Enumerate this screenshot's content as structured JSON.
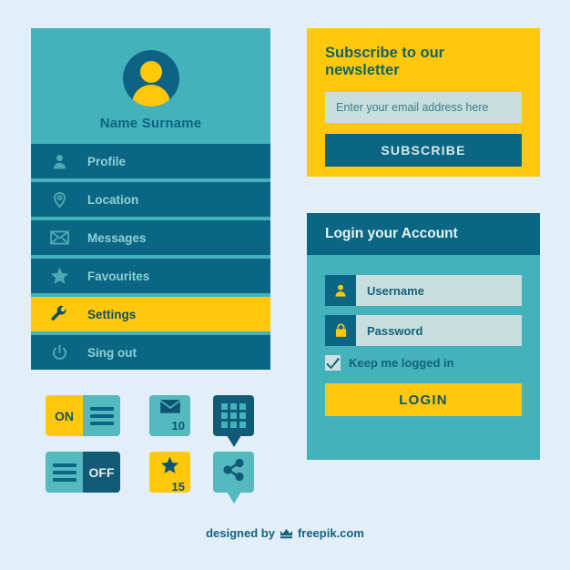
{
  "colors": {
    "page_bg": "#e2eff8",
    "teal": "#43b2ba",
    "teal_light": "#55b9c0",
    "dark_blue": "#0b6683",
    "yellow": "#ffc80d",
    "input_bg": "#c6dfdc",
    "menu_text": "#8fd0d6"
  },
  "profile_card": {
    "avatar_icon": "user-avatar-icon",
    "name": "Name Surname",
    "menu": [
      {
        "label": "Profile",
        "icon": "person-icon",
        "active": false
      },
      {
        "label": "Location",
        "icon": "map-pin-icon",
        "active": false
      },
      {
        "label": "Messages",
        "icon": "envelope-icon",
        "active": false
      },
      {
        "label": "Favourites",
        "icon": "star-icon",
        "active": false
      },
      {
        "label": "Settings",
        "icon": "wrench-icon",
        "active": true
      },
      {
        "label": "Sing out",
        "icon": "power-icon",
        "active": false
      }
    ]
  },
  "newsletter": {
    "title": "Subscribe to our newsletter",
    "email_placeholder": "Enter your email address here",
    "email_value": "",
    "subscribe_label": "SUBSCRIBE"
  },
  "login": {
    "title": "Login your Account",
    "username_icon": "person-icon",
    "username_label": "Username",
    "password_icon": "lock-icon",
    "password_label": "Password",
    "keep_logged_in_label": "Keep me logged in",
    "keep_logged_in_checked": true,
    "checkbox_icon": "checkmark-icon",
    "login_label": "LOGIN"
  },
  "widgets": {
    "toggle_on": {
      "label": "ON",
      "state": "on",
      "icon": "hamburger-icon"
    },
    "toggle_off": {
      "label": "OFF",
      "state": "off",
      "icon": "hamburger-icon"
    },
    "messages_tile": {
      "icon": "envelope-icon",
      "count": "10"
    },
    "favourites_tile": {
      "icon": "star-icon",
      "count": "15"
    },
    "grid_tile": {
      "icon": "grid-icon"
    },
    "share_tile": {
      "icon": "share-icon"
    }
  },
  "footer": {
    "prefix": "designed by",
    "crown_icon": "crown-icon",
    "brand": "freepik.com"
  }
}
